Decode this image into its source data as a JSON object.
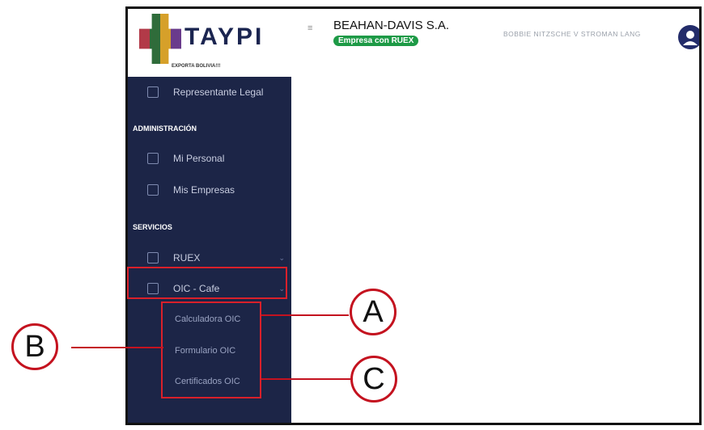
{
  "sidebar": {
    "logo_text": "TAYPI",
    "logo_tagline": "EXPORTA BOLIVIA!!!",
    "items": [
      {
        "label": "Representante Legal"
      },
      {
        "label": "Mi Personal"
      },
      {
        "label": "Mis Empresas"
      },
      {
        "label": "RUEX"
      },
      {
        "label": "OIC - Cafe"
      }
    ],
    "sections": {
      "administracion": "ADMINISTRACIÓN",
      "servicios": "SERVICIOS"
    },
    "submenu": [
      "Calculadora OIC",
      "Formulario OIC",
      "Certificados OIC"
    ]
  },
  "header": {
    "company": "BEAHAN-DAVIS S.A.",
    "badge": "Empresa con RUEX",
    "user": "BOBBIE NITZSCHE V STROMAN LANG",
    "hamburger": "≡"
  },
  "callouts": {
    "a": "A",
    "b": "B",
    "c": "C"
  },
  "colors": {
    "sidebar": "#1c2547",
    "badge": "#1d9a46",
    "highlight": "#d9202a"
  }
}
